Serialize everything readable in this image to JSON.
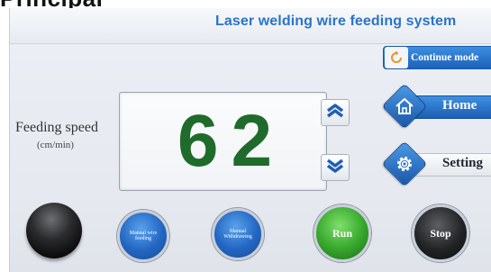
{
  "caption": {
    "text": "Principal"
  },
  "header": {
    "title": "Laser welding wire feeding system"
  },
  "mode_button": {
    "label": "Continue mode",
    "icon": "refresh-icon"
  },
  "feeding_speed": {
    "label": "Feeding speed",
    "unit": "(cm/min)",
    "value": "62"
  },
  "arrows": {
    "up_icon": "chevron-up-icon",
    "down_icon": "chevron-down-icon"
  },
  "nav": {
    "home_label": "Home",
    "home_icon": "home-icon",
    "setting_label": "Setting",
    "setting_icon": "gear-icon"
  },
  "controls": {
    "manual_feeding": "Manual wire feeding",
    "manual_withdrawing": "Manual Withdrawing",
    "run": "Run",
    "stop": "Stop"
  },
  "colors": {
    "title_blue": "#2b73c7",
    "button_blue": "#1d62b8",
    "digits_green": "#1f6b2c",
    "run_green": "#35a52b",
    "stop_black": "#222325"
  }
}
